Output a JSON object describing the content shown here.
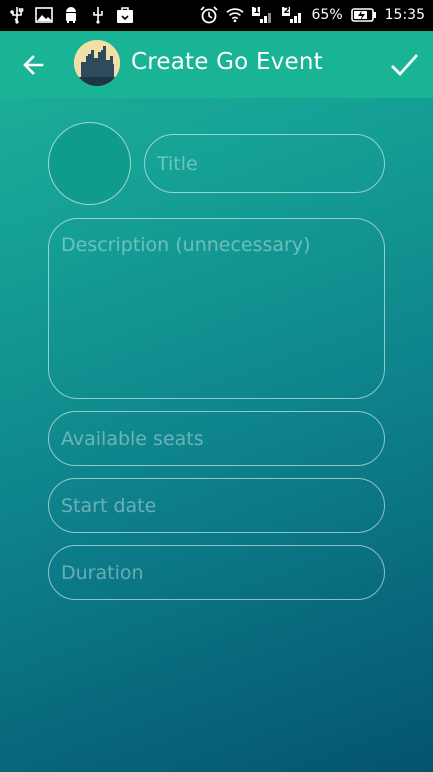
{
  "status_bar": {
    "battery_percent": "65%",
    "time": "15:35",
    "sim1": "1",
    "sim2": "2"
  },
  "app_bar": {
    "title": "Create Go Event",
    "background": "#19b496"
  },
  "form": {
    "title_placeholder": "Title",
    "description_placeholder": "Description (unnecessary)",
    "seats_placeholder": "Available seats",
    "start_date_placeholder": "Start date",
    "duration_placeholder": "Duration"
  }
}
